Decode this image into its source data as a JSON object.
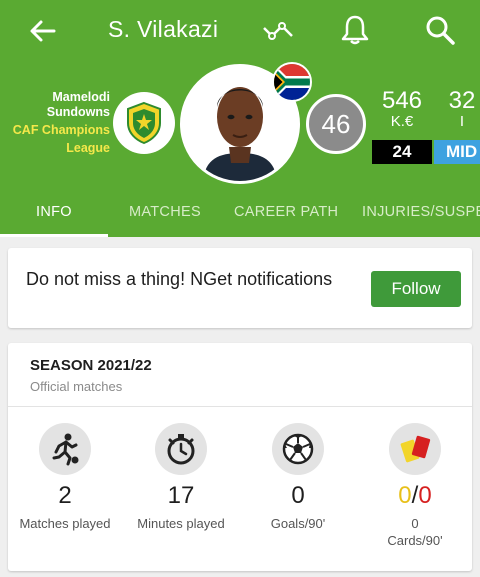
{
  "header": {
    "title": "S. Vilakazi",
    "team_line1": "Mamelodi",
    "team_line2": "Sundowns",
    "competition_line1": "CAF Champions",
    "competition_line2": "League",
    "shirt_number": "46",
    "market_value": "546",
    "market_value_unit": "K.€",
    "secondary_number": "32",
    "secondary_unit": "I",
    "age": "24",
    "position": "MID"
  },
  "tabs": [
    {
      "label": "INFO",
      "active": true
    },
    {
      "label": "MATCHES",
      "active": false
    },
    {
      "label": "CAREER PATH",
      "active": false
    },
    {
      "label": "INJURIES/SUSPENSIONS",
      "active": false
    }
  ],
  "notify": {
    "text": "Do not miss a thing!  NGet notifications",
    "button": "Follow"
  },
  "season": {
    "title": "SEASON 2021/22",
    "subtitle": "Official matches",
    "stats": [
      {
        "icon": "player-running-icon",
        "value": "2",
        "label": "Matches played"
      },
      {
        "icon": "stopwatch-icon",
        "value": "17",
        "label": "Minutes played"
      },
      {
        "icon": "soccer-ball-icon",
        "value": "0",
        "label": "Goals/90'"
      },
      {
        "icon": "cards-icon",
        "value_yellow": "0",
        "value_sep": "/",
        "value_red": "0",
        "label_line1": "0",
        "label_line2": "Cards/90'"
      }
    ]
  },
  "colors": {
    "header_green": "#5aaa32",
    "follow_green": "#3f9a3a",
    "position_blue": "#3ea2e0",
    "competition_yellow": "#f5e84a",
    "yellow_card": "#e8c01a",
    "red_card": "#d62020"
  }
}
